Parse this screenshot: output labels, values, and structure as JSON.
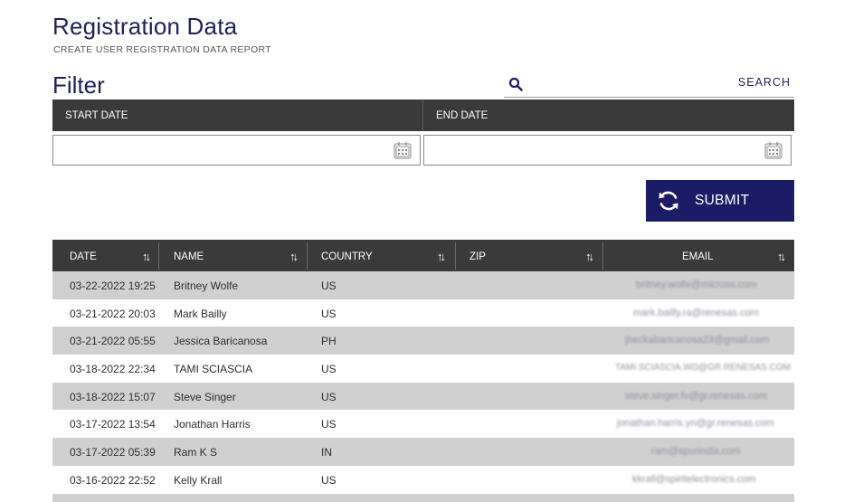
{
  "header": {
    "title": "Registration Data",
    "subtitle": "CREATE USER REGISTRATION DATA REPORT"
  },
  "filter": {
    "title": "Filter",
    "search": {
      "label": "SEARCH",
      "value": "",
      "icon": "search-icon"
    },
    "start_date": {
      "label": "START DATE",
      "value": "",
      "icon": "calendar-icon"
    },
    "end_date": {
      "label": "END DATE",
      "value": "",
      "icon": "calendar-icon"
    },
    "submit": {
      "label": "SUBMIT",
      "icon": "refresh-icon"
    }
  },
  "table": {
    "columns": [
      "DATE",
      "NAME",
      "COUNTRY",
      "ZIP",
      "EMAIL"
    ],
    "sort_icon": "⇅",
    "rows": [
      {
        "date": "03-22-2022 19:25",
        "name": "Britney Wolfe",
        "country": "US",
        "zip": "",
        "email": "britney.wolfe@micross.com"
      },
      {
        "date": "03-21-2022 20:03",
        "name": "Mark Bailly",
        "country": "US",
        "zip": "",
        "email": "mark.bailly.ra@renesas.com"
      },
      {
        "date": "03-21-2022 05:55",
        "name": "Jessica Baricanosa",
        "country": "PH",
        "zip": "",
        "email": "jheckabaricanosa23@gmail.com"
      },
      {
        "date": "03-18-2022 22:34",
        "name": "TAMI SCIASCIA",
        "country": "US",
        "zip": "",
        "email": "TAMI.SCIASCIA.WD@GR.RENESAS.COM"
      },
      {
        "date": "03-18-2022 15:07",
        "name": "Steve Singer",
        "country": "US",
        "zip": "",
        "email": "steve.singer.fv@gr.renesas.com"
      },
      {
        "date": "03-17-2022 13:54",
        "name": "Jonathan Harris",
        "country": "US",
        "zip": "",
        "email": "jonathan.harris.yn@gr.renesas.com"
      },
      {
        "date": "03-17-2022 05:39",
        "name": "Ram K S",
        "country": "IN",
        "zip": "",
        "email": "ram@spurindia.com"
      },
      {
        "date": "03-16-2022 22:52",
        "name": "Kelly Krall",
        "country": "US",
        "zip": "",
        "email": "kkrall@spiritelectronics.com"
      }
    ]
  },
  "colors": {
    "brand": "#1c1c66",
    "header_bg": "#3a3a3a",
    "row_alt": "#d0d0d0"
  }
}
